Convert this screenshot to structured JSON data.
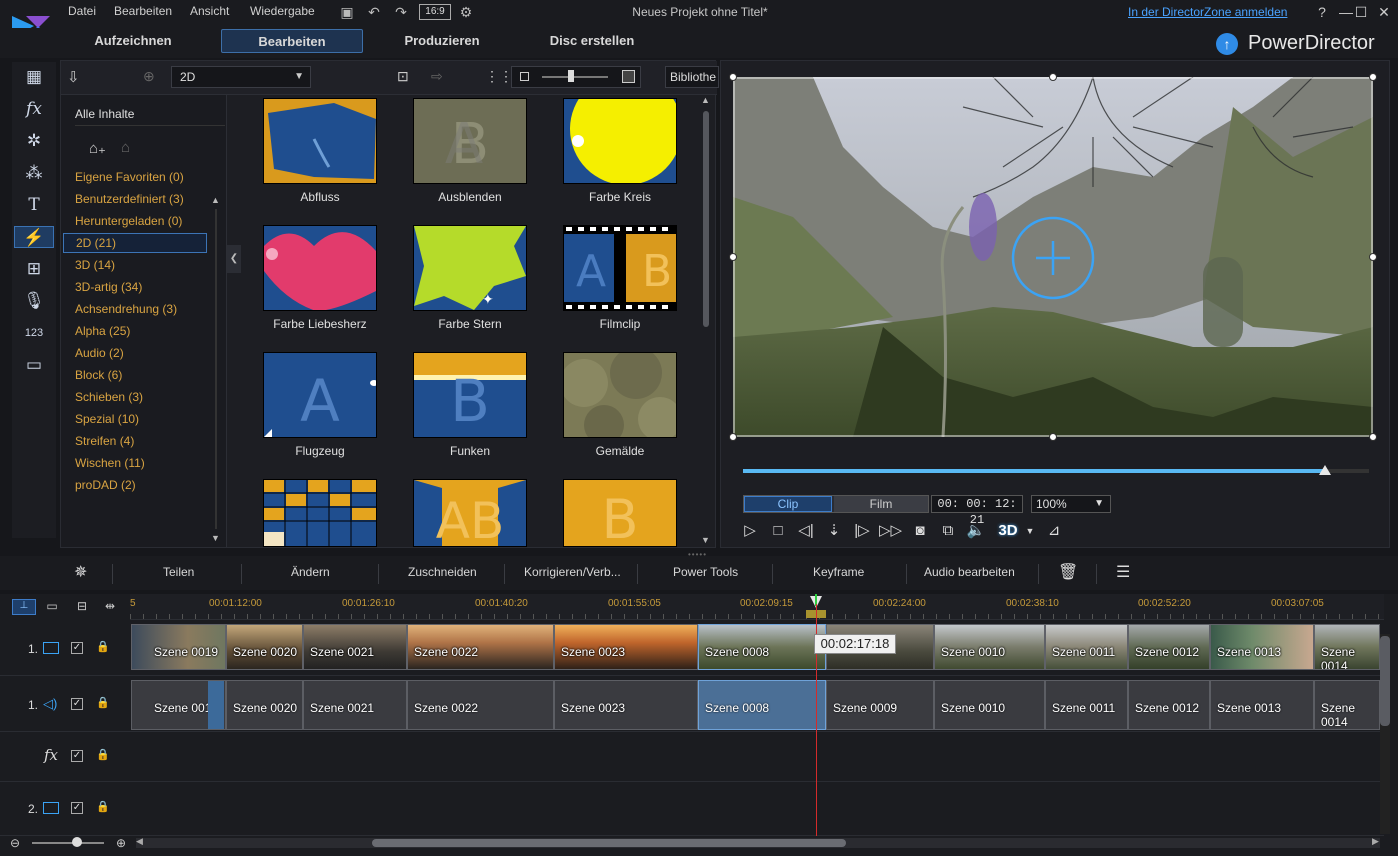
{
  "menu": [
    "Datei",
    "Bearbeiten",
    "Ansicht",
    "Wiedergabe"
  ],
  "project_title": "Neues Projekt ohne Titel*",
  "directorzone_link": "In der DirectorZone anmelden",
  "aspect_ratio": "16:9",
  "brand": "PowerDirector",
  "mode_tabs": [
    "Aufzeichnen",
    "Bearbeiten",
    "Produzieren",
    "Disc erstellen"
  ],
  "active_mode_tab": "Bearbeiten",
  "library": {
    "filter_dropdown": "2D",
    "library_button": "Bibliothe",
    "all_content": "Alle Inhalte",
    "categories": [
      {
        "label": "Eigene Favoriten  (0)"
      },
      {
        "label": "Benutzerdefiniert  (3)"
      },
      {
        "label": "Heruntergeladen  (0)"
      },
      {
        "label": "2D  (21)"
      },
      {
        "label": "3D  (14)"
      },
      {
        "label": "3D-artig  (34)"
      },
      {
        "label": "Achsendrehung  (3)"
      },
      {
        "label": "Alpha  (25)"
      },
      {
        "label": "Audio  (2)"
      },
      {
        "label": "Block  (6)"
      },
      {
        "label": "Schieben  (3)"
      },
      {
        "label": "Spezial  (10)"
      },
      {
        "label": "Streifen  (4)"
      },
      {
        "label": "Wischen  (11)"
      },
      {
        "label": "proDAD  (2)"
      }
    ],
    "selected_category": "2D  (21)",
    "transitions": [
      "Abfluss",
      "Ausblenden",
      "Farbe Kreis",
      "Farbe Liebesherz",
      "Farbe Stern",
      "Filmclip",
      "Flugzeug",
      "Funken",
      "Gemälde"
    ]
  },
  "preview": {
    "clip_label": "Clip",
    "film_label": "Film",
    "timecode": "00: 00: 12: 21",
    "zoom": "100%",
    "progress_fraction": 0.93
  },
  "edit_tools": [
    "Teilen",
    "Ändern",
    "Zuschneiden",
    "Korrigieren/Verb...",
    "Power Tools",
    "Keyframe",
    "Audio bearbeiten"
  ],
  "ruler_ticks": [
    "5",
    "00:01:12:00",
    "00:01:26:10",
    "00:01:40:20",
    "00:01:55:05",
    "00:02:09:15",
    "00:02:24:00",
    "00:02:38:10",
    "00:02:52:20",
    "00:03:07:05"
  ],
  "tracks": {
    "video_num": "1.",
    "audio_num": "1.",
    "video2_num": "2."
  },
  "video_clips": [
    "Szene 0019",
    "Szene 0020",
    "Szene 0021",
    "Szene 0022",
    "Szene 0023",
    "Szene 0008",
    "",
    "Szene 0010",
    "Szene 0011",
    "Szene 0012",
    "Szene 0013",
    "Szene 0014"
  ],
  "audio_clips": [
    "Szene 0019",
    "Szene 0020",
    "Szene 0021",
    "Szene 0022",
    "Szene 0023",
    "Szene 0008",
    "Szene 0009",
    "Szene 0010",
    "Szene 0011",
    "Szene 0012",
    "Szene 0013",
    "Szene 0014"
  ],
  "playhead_tooltip": "00:02:17:18",
  "colors": {
    "accent": "#3d7cc9",
    "category_text": "#d9a442",
    "playhead": "#d42b2b"
  }
}
